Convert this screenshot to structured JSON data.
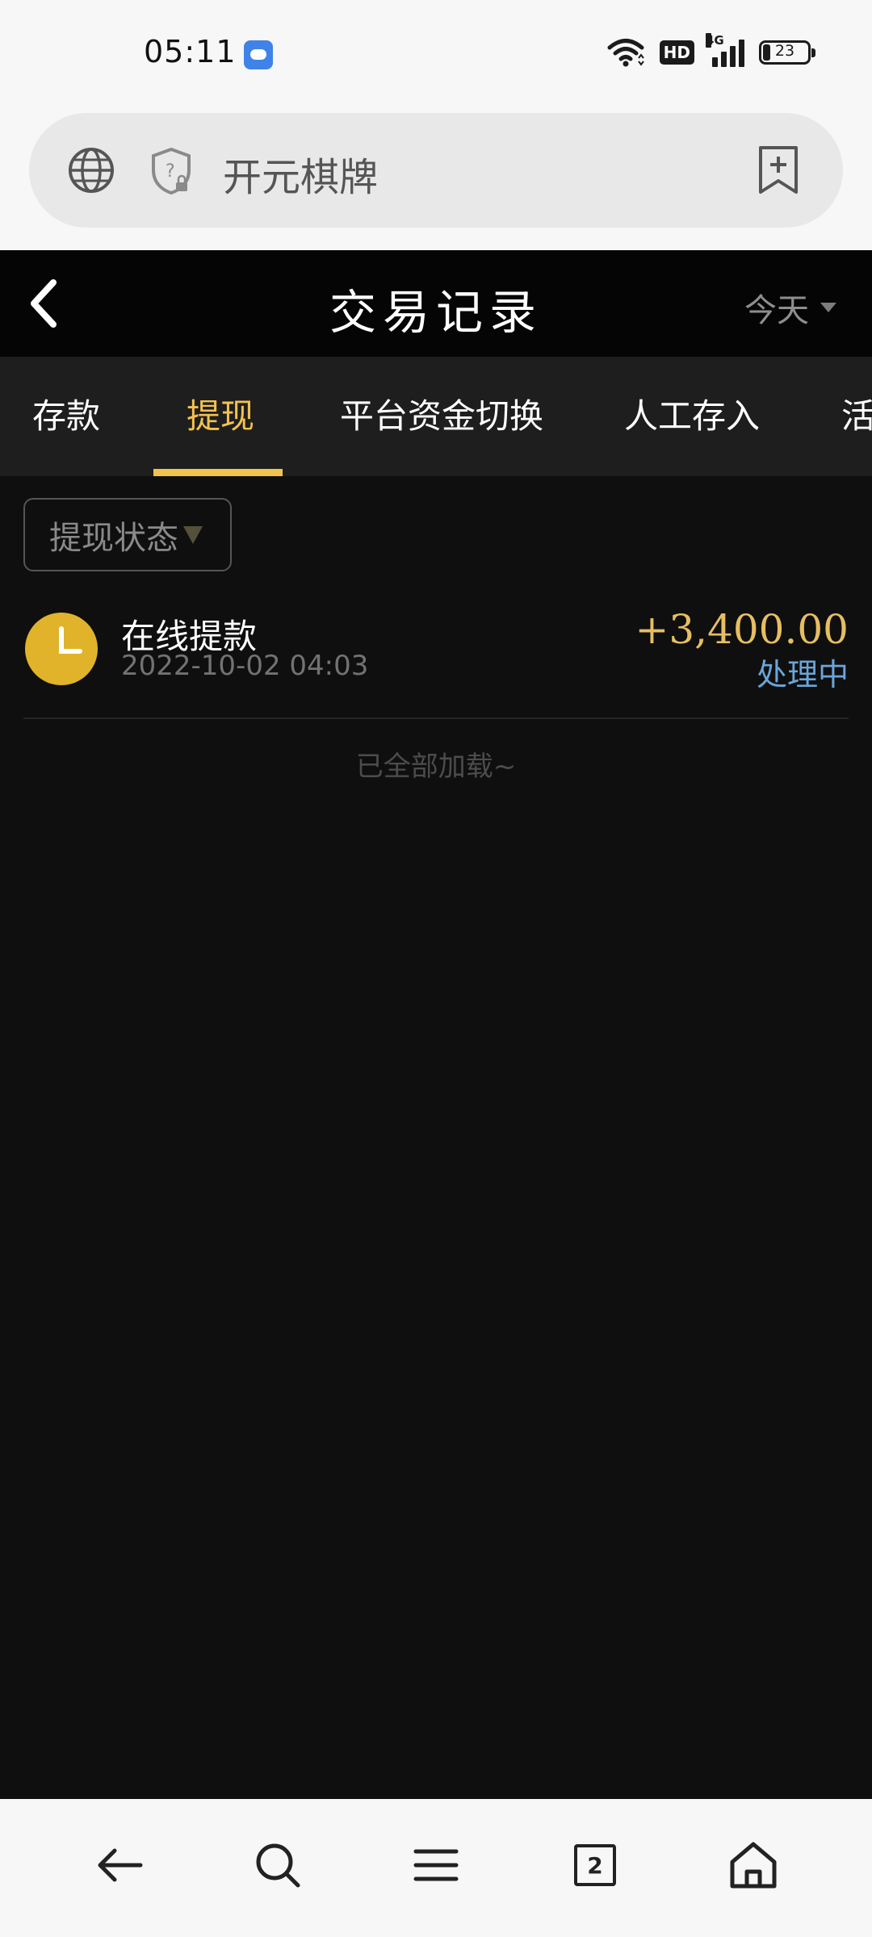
{
  "status_bar": {
    "time": "05:11",
    "network_badge": "HD",
    "network_type": "4G",
    "battery_level": 23,
    "battery_text": "23"
  },
  "browser": {
    "url_text": "开元棋牌",
    "tab_count": "2"
  },
  "header": {
    "title": "交易记录",
    "date_filter": "今天"
  },
  "tabs": [
    {
      "label": "存款",
      "active": false
    },
    {
      "label": "提现",
      "active": true
    },
    {
      "label": "平台资金切换",
      "active": false
    },
    {
      "label": "人工存入",
      "active": false
    },
    {
      "label": "活",
      "active": false
    }
  ],
  "filter": {
    "label": "提现状态"
  },
  "records": [
    {
      "title": "在线提款",
      "time": "2022-10-02 04:03",
      "amount": "+3,400.00",
      "status": "处理中"
    }
  ],
  "footer_text": "已全部加载~",
  "colors": {
    "accent": "#f2c24e",
    "amount": "#e6be62",
    "status": "#6aa5da",
    "background": "#0f0f0f"
  },
  "icons": {
    "nav": [
      "back-arrow-icon",
      "search-icon",
      "menu-icon",
      "tabs-icon",
      "home-icon"
    ]
  }
}
